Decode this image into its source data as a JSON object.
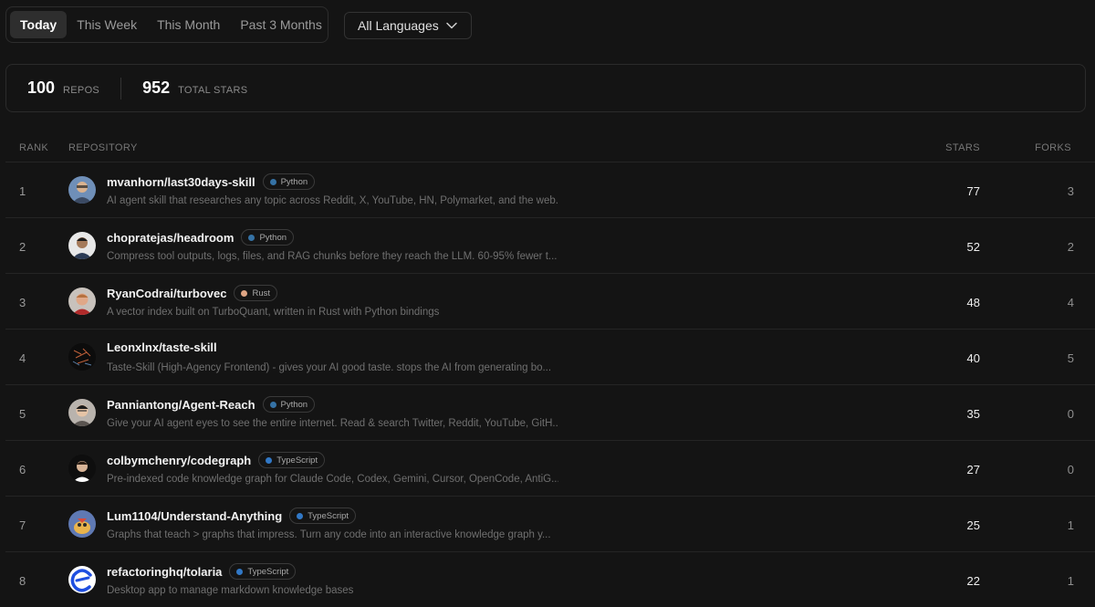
{
  "tabs": [
    {
      "label": "Today",
      "active": true
    },
    {
      "label": "This Week",
      "active": false
    },
    {
      "label": "This Month",
      "active": false
    },
    {
      "label": "Past 3 Months",
      "active": false
    }
  ],
  "language_filter": {
    "selected": "All Languages"
  },
  "stats": {
    "repos_count": "100",
    "repos_label": "REPOS",
    "stars_count": "952",
    "stars_label": "TOTAL STARS"
  },
  "table": {
    "headers": {
      "rank": "RANK",
      "repository": "REPOSITORY",
      "stars": "STARS",
      "forks": "FORKS"
    },
    "rows": [
      {
        "rank": "1",
        "name": "mvanhorn/last30days-skill",
        "language": "Python",
        "lang_color": "#3572A5",
        "description": "AI agent skill that researches any topic across Reddit, X, YouTube, HN, Polymarket, and the web...",
        "stars": "77",
        "forks": "3"
      },
      {
        "rank": "2",
        "name": "chopratejas/headroom",
        "language": "Python",
        "lang_color": "#3572A5",
        "description": "Compress tool outputs, logs, files, and RAG chunks before they reach the LLM. 60-95% fewer t...",
        "stars": "52",
        "forks": "2"
      },
      {
        "rank": "3",
        "name": "RyanCodrai/turbovec",
        "language": "Rust",
        "lang_color": "#dea584",
        "description": "A vector index built on TurboQuant, written in Rust with Python bindings",
        "stars": "48",
        "forks": "4"
      },
      {
        "rank": "4",
        "name": "Leonxlnx/taste-skill",
        "language": "",
        "lang_color": "",
        "description": "Taste-Skill (High-Agency Frontend) - gives your AI good taste. stops the AI from generating bo...",
        "stars": "40",
        "forks": "5"
      },
      {
        "rank": "5",
        "name": "Panniantong/Agent-Reach",
        "language": "Python",
        "lang_color": "#3572A5",
        "description": "Give your AI agent eyes to see the entire internet. Read & search Twitter, Reddit, YouTube, GitH...",
        "stars": "35",
        "forks": "0"
      },
      {
        "rank": "6",
        "name": "colbymchenry/codegraph",
        "language": "TypeScript",
        "lang_color": "#3178c6",
        "description": "Pre-indexed code knowledge graph for Claude Code, Codex, Gemini, Cursor, OpenCode, AntiG...",
        "stars": "27",
        "forks": "0"
      },
      {
        "rank": "7",
        "name": "Lum1104/Understand-Anything",
        "language": "TypeScript",
        "lang_color": "#3178c6",
        "description": "Graphs that teach > graphs that impress. Turn any code into an interactive knowledge graph y...",
        "stars": "25",
        "forks": "1"
      },
      {
        "rank": "8",
        "name": "refactoringhq/tolaria",
        "language": "TypeScript",
        "lang_color": "#3178c6",
        "description": "Desktop app to manage markdown knowledge bases",
        "stars": "22",
        "forks": "1"
      }
    ]
  }
}
